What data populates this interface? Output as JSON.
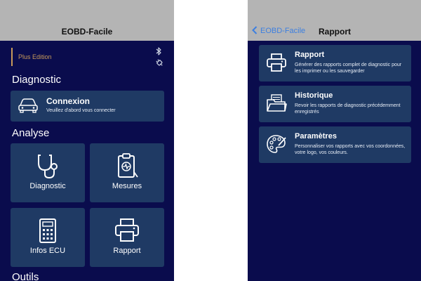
{
  "left_screen": {
    "navbar": {
      "title": "EOBD-Facile"
    },
    "edition_label": "Plus Edition",
    "status_icons": [
      "bluetooth-icon",
      "plug-icon"
    ],
    "diagnostic": {
      "title": "Diagnostic",
      "connection": {
        "title": "Connexion",
        "subtitle": "Veuillez d'abord vous connecter",
        "icon": "car-icon"
      }
    },
    "analyse": {
      "title": "Analyse",
      "tiles": [
        {
          "label": "Diagnostic",
          "icon": "stethoscope-icon"
        },
        {
          "label": "Mesures",
          "icon": "clipboard-chart-icon"
        },
        {
          "label": "Infos ECU",
          "icon": "calculator-icon"
        },
        {
          "label": "Rapport",
          "icon": "printer-icon"
        }
      ]
    },
    "outils": {
      "title": "Outils"
    }
  },
  "right_screen": {
    "navbar": {
      "back_label": "EOBD-Facile",
      "title": "Rapport"
    },
    "items": [
      {
        "title": "Rapport",
        "description": "Générer des rapports complet de diagnostic pour les imprimer ou les sauvegarder",
        "icon": "printer-icon"
      },
      {
        "title": "Historique",
        "description": "Revoir les rapports de diagnostic précédemment enregistrés",
        "icon": "folder-history-icon"
      },
      {
        "title": "Paramètres",
        "description": "Personnaliser vos rapports avec vos coordonnées, votre logo, vos couleurs.",
        "icon": "palette-icon"
      }
    ]
  },
  "colors": {
    "background": "#0a0c4d",
    "card": "#1f3a64",
    "navbar": "#b4b4b4",
    "accent_gold": "#c89a5a",
    "link_blue": "#3d7fe0"
  }
}
